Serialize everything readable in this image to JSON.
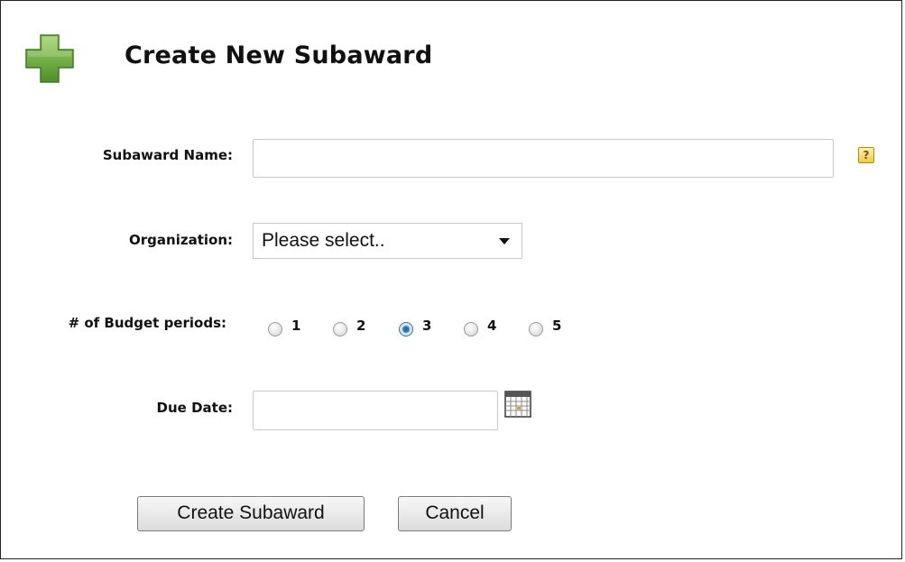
{
  "header": {
    "title": "Create New Subaward",
    "icon": "plus-icon",
    "icon_color": "#6aab3a"
  },
  "form": {
    "subaward_name": {
      "label": "Subaward Name:",
      "value": "",
      "help_icon": "?"
    },
    "organization": {
      "label": "Organization:",
      "selected": "Please select.."
    },
    "budget_periods": {
      "label": "# of Budget periods:",
      "options": [
        "1",
        "2",
        "3",
        "4",
        "5"
      ],
      "selected": "3"
    },
    "due_date": {
      "label": "Due Date:",
      "value": "",
      "icon": "calendar-icon"
    }
  },
  "actions": {
    "create_label": "Create Subaward",
    "cancel_label": "Cancel"
  }
}
